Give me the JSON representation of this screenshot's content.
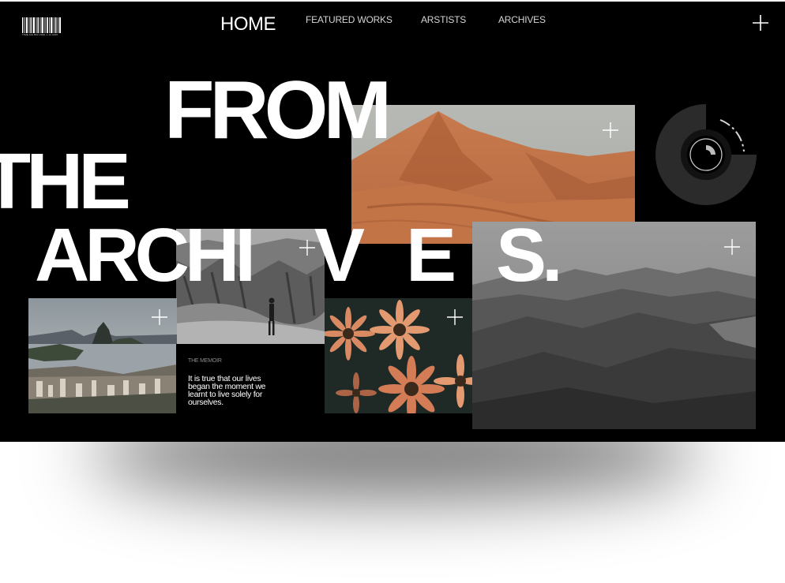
{
  "nav": {
    "barcode_text": "TIME.MO.BIR.2000.1.12.0007",
    "home": "HOME",
    "links": [
      "FEATURED WORKS",
      "ARSTISTS",
      "ARCHIVES"
    ],
    "menu_icon": "plus-icon"
  },
  "hero": {
    "line1": "FROM",
    "line2": "THE",
    "line3_letters": [
      "ARCHI",
      "V",
      "E",
      "S."
    ]
  },
  "memoir": {
    "tag": "THE MEMOIR",
    "text": "It is true that our lives began the moment we learnt to live solely for ourselves."
  },
  "photos": [
    "desert",
    "canyon",
    "rio",
    "flowers",
    "mountains"
  ],
  "colors": {
    "background": "#000000",
    "text": "#ffffff",
    "desert": "#c9764a",
    "flowers": "#d9825a"
  }
}
